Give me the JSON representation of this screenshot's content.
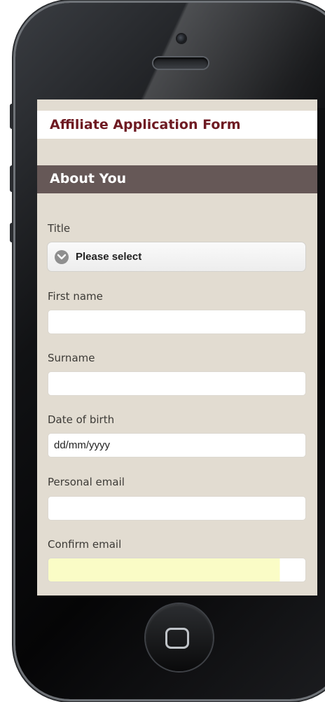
{
  "form": {
    "title": "Affiliate Application Form",
    "section_title": "About You"
  },
  "fields": {
    "title": {
      "label": "Title",
      "selected": "Please select"
    },
    "first_name": {
      "label": "First name",
      "value": ""
    },
    "surname": {
      "label": "Surname",
      "value": ""
    },
    "date_of_birth": {
      "label": "Date of birth",
      "placeholder": "dd/mm/yyyy",
      "value": ""
    },
    "personal_email": {
      "label": "Personal email",
      "value": ""
    },
    "confirm_email": {
      "label": "Confirm email",
      "value": ""
    }
  },
  "icons": {
    "select": "chevron-down-circle-icon",
    "home": "home-button-icon"
  },
  "colors": {
    "title_text": "#6e1a22",
    "section_bar": "#665857",
    "screen_bg": "#e2dcd1",
    "autofill": "#fafcc6"
  }
}
